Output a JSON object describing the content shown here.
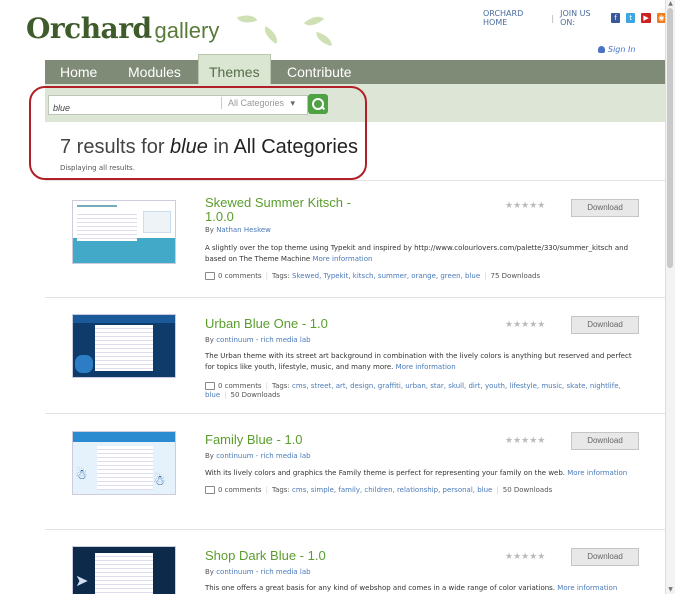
{
  "header": {
    "logo_main": "Orchard",
    "logo_sub": "gallery",
    "orchard_home": "ORCHARD HOME",
    "join_us": "JOIN US ON:",
    "social": [
      {
        "icon": "facebook-icon",
        "glyph": "f",
        "color": "#3b5998"
      },
      {
        "icon": "twitter-icon",
        "glyph": "t",
        "color": "#3ea7e2"
      },
      {
        "icon": "youtube-icon",
        "glyph": "▶",
        "color": "#cc2222"
      },
      {
        "icon": "rss-icon",
        "glyph": "◉",
        "color": "#ef7c1f"
      }
    ],
    "sign_in": "Sign In"
  },
  "nav": {
    "tabs": [
      {
        "label": "Home"
      },
      {
        "label": "Modules"
      },
      {
        "label": "Themes"
      },
      {
        "label": "Contribute"
      }
    ],
    "active": "Themes"
  },
  "search": {
    "value": "blue",
    "category": "All Categories",
    "category_arrow": "▾"
  },
  "results": {
    "count_text": "7 results for",
    "query": "blue",
    "in_text": "in",
    "category": "All Categories",
    "sub": "Displaying all results."
  },
  "items": [
    {
      "title": "Skewed Summer Kitsch - 1.0.0",
      "by": "By",
      "author": "Nathan Heskew",
      "desc": "A slightly over the top theme using Typekit and inspired by http://www.colourlovers.com/palette/330/summer_kitsch and based on The Theme Machine",
      "more": "More information",
      "comments": "0 comments",
      "tags_label": "Tags:",
      "tags": "Skewed, Typekit, kitsch, summer, orange, green, blue",
      "downloads": "75 Downloads",
      "stars": "★★★★★",
      "download": "Download"
    },
    {
      "title": "Urban Blue One - 1.0",
      "by": "By",
      "author": "continuum - rich media lab",
      "desc": "The Urban theme with its street art background in combination with the lively colors is anything but reserved and perfect for topics like youth, lifestyle, music, and many more.",
      "more": "More information",
      "comments": "0 comments",
      "tags_label": "Tags:",
      "tags": "cms, street, art, design, graffiti, urban, star, skull, dirt, youth, lifestyle, music, skate, nightlife, blue",
      "downloads": "50 Downloads",
      "stars": "★★★★★",
      "download": "Download"
    },
    {
      "title": "Family Blue - 1.0",
      "by": "By",
      "author": "continuum - rich media lab",
      "desc": "With its lively colors and graphics the Family theme is perfect for representing your family on the web.",
      "more": "More information",
      "comments": "0 comments",
      "tags_label": "Tags:",
      "tags": "cms, simple, family, children, relationship, personal, blue",
      "downloads": "50 Downloads",
      "stars": "★★★★★",
      "download": "Download"
    },
    {
      "title": "Shop Dark Blue - 1.0",
      "by": "By",
      "author": "continuum - rich media lab",
      "desc": "This one offers a great basis for any kind of webshop and comes in a wide range of color variations.",
      "more": "More information",
      "stars": "★★★★★",
      "download": "Download"
    }
  ]
}
